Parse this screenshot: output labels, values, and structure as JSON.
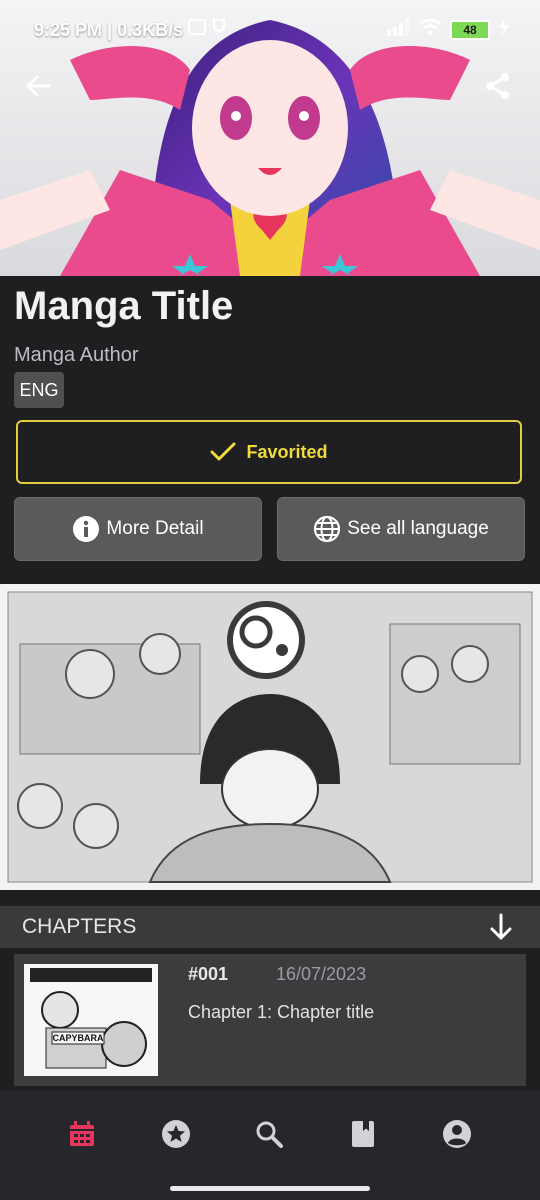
{
  "status_bar": {
    "time": "9:25 PM",
    "speed": "0.3KB/s",
    "battery": "48"
  },
  "manga": {
    "title": "Manga Title",
    "author": "Manga Author",
    "language": "ENG"
  },
  "actions": {
    "favorite_label": "Favorited",
    "more_detail_label": "More Detail",
    "see_all_language_label": "See all language"
  },
  "chapters": {
    "header": "CHAPTERS",
    "items": [
      {
        "number": "#001",
        "date": "16/07/2023",
        "title": "Chapter 1: Chapter title",
        "thumb_text": "CAPYBARA"
      }
    ]
  },
  "nav": {
    "active": "calendar",
    "items": [
      "calendar",
      "favorites",
      "search",
      "library",
      "profile"
    ]
  },
  "colors": {
    "accent_favorite": "#e3cf3d",
    "nav_active": "#e8355e",
    "background": "#1f1f21"
  }
}
